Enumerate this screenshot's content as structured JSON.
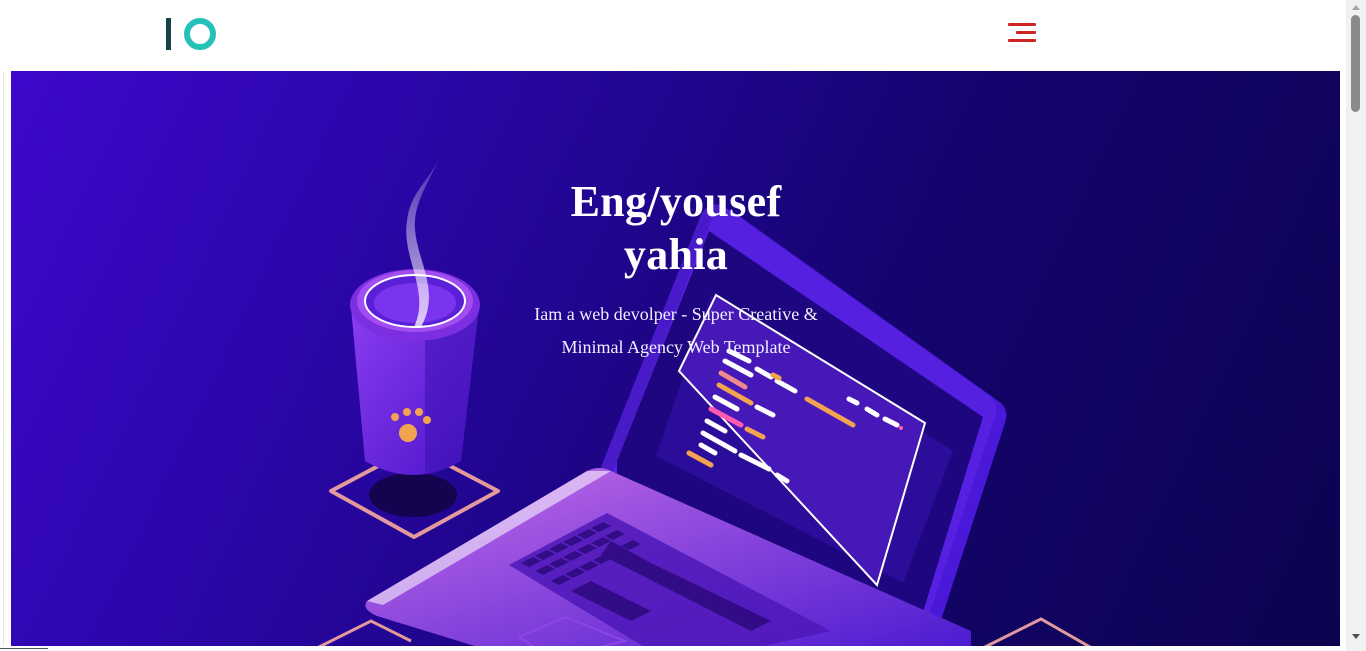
{
  "brand": {
    "logo_text": "IO",
    "colors": {
      "bar": "#14414a",
      "ring": "#25c2b8"
    }
  },
  "nav": {
    "menu_icon": "hamburger-menu-icon",
    "menu_color": "#cf2424"
  },
  "hero": {
    "title_line1": "Eng/yousef",
    "title_line2": "yahia",
    "subtitle_line1": "Iam a web devolper - Super Creative &",
    "subtitle_line2": "Minimal Agency Web Template",
    "background_colors": [
      "#3d08cc",
      "#0c0350"
    ]
  },
  "scrollbar": {
    "thumb_icon": "scroll-thumb",
    "up_icon": "scroll-up-arrow-icon",
    "down_icon": "scroll-down-arrow-icon"
  }
}
